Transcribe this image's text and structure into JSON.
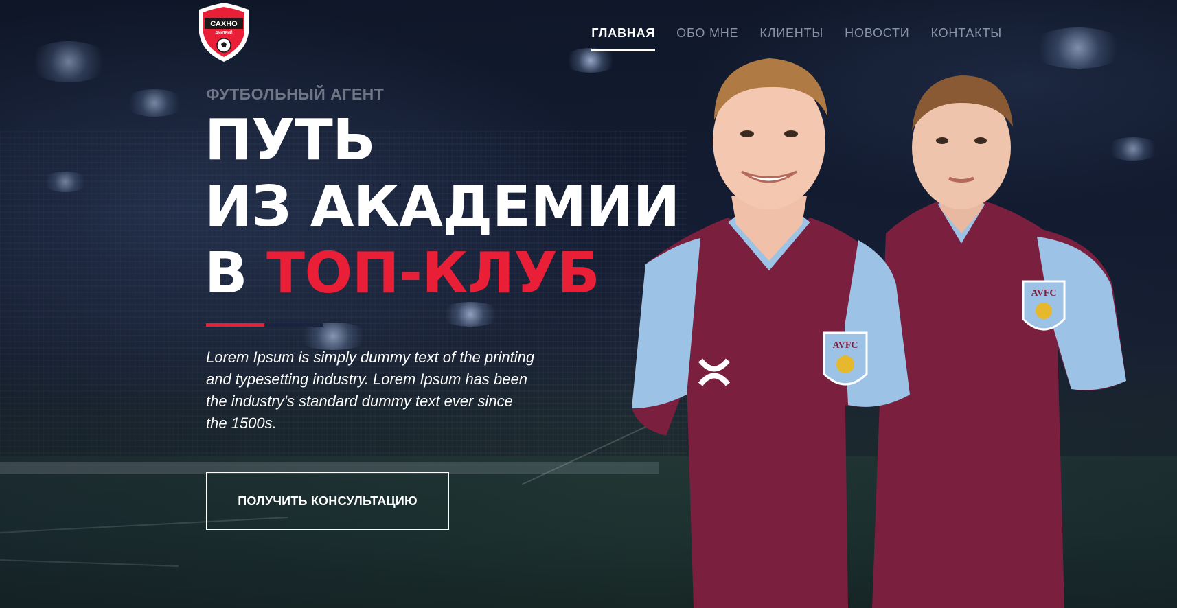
{
  "brand": {
    "logo_top_text": "САХНО",
    "logo_sub_text": "ДМИТРИЙ",
    "colors": {
      "accent_red": "#e81f36",
      "navy": "#0e1526",
      "muted_nav": "#8a93a6",
      "kit_claret": "#7a1f3d",
      "kit_sky_blue": "#9cc3e6"
    }
  },
  "nav": {
    "items": [
      {
        "label": "ГЛАВНАЯ",
        "active": true
      },
      {
        "label": "ОБО МНЕ",
        "active": false
      },
      {
        "label": "КЛИЕНТЫ",
        "active": false
      },
      {
        "label": "НОВОСТИ",
        "active": false
      },
      {
        "label": "КОНТАКТЫ",
        "active": false
      }
    ]
  },
  "hero": {
    "eyebrow": "ФУТБОЛЬНЫЙ АГЕНТ",
    "headline_line1": "ПУТЬ",
    "headline_line2": "ИЗ АКАДЕМИИ",
    "headline_line3_prefix": "В ",
    "headline_line3_accent": "ТОП-КЛУБ",
    "lead": "Lorem Ipsum is simply dummy text of the printing and typesetting industry. Lorem Ipsum has been the industry's standard dummy text ever since the 1500s.",
    "cta_label": "ПОЛУЧИТЬ КОНСУЛЬТАЦИЮ"
  },
  "players_image": {
    "badge_text": "AVFC",
    "icons": [
      "club-crest-icon",
      "kit-brand-logo-icon",
      "football-icon"
    ]
  }
}
